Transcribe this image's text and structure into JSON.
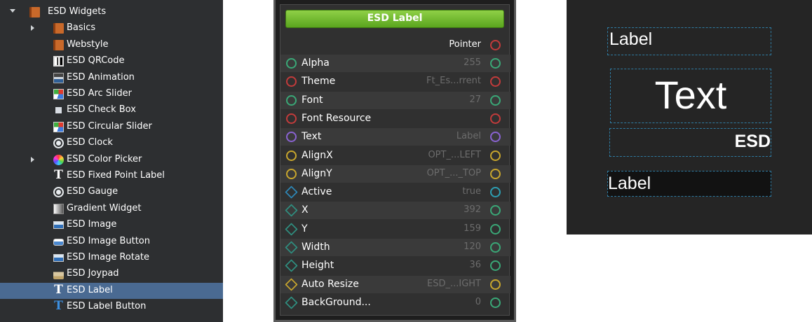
{
  "tree": {
    "items": [
      {
        "label": "ESD Widgets",
        "icon": "folder-book-icon",
        "expand": "expanded"
      },
      {
        "label": "Basics",
        "icon": "folder-book-icon",
        "expand": "collapsed"
      },
      {
        "label": "Webstyle",
        "icon": "folder-book-icon",
        "expand": "none"
      },
      {
        "label": "ESD QRCode",
        "icon": "qr-code-icon",
        "expand": "none"
      },
      {
        "label": "ESD Animation",
        "icon": "animation-icon",
        "expand": "none"
      },
      {
        "label": "ESD Arc Slider",
        "icon": "arc-slider-icon",
        "expand": "none"
      },
      {
        "label": "ESD Check Box",
        "icon": "checkbox-icon",
        "expand": "none"
      },
      {
        "label": "ESD Circular Slider",
        "icon": "circular-slider-icon",
        "expand": "none"
      },
      {
        "label": "ESD Clock",
        "icon": "clock-icon",
        "expand": "none"
      },
      {
        "label": "ESD Color Picker",
        "icon": "color-wheel-icon",
        "expand": "collapsed"
      },
      {
        "label": "ESD Fixed Point Label",
        "icon": "text-t-icon",
        "expand": "none"
      },
      {
        "label": "ESD Gauge",
        "icon": "gauge-icon",
        "expand": "none"
      },
      {
        "label": "Gradient Widget",
        "icon": "gradient-icon",
        "expand": "none"
      },
      {
        "label": "ESD Image",
        "icon": "image-icon",
        "expand": "none"
      },
      {
        "label": "ESD Image Button",
        "icon": "image-button-icon",
        "expand": "none"
      },
      {
        "label": "ESD Image Rotate",
        "icon": "image-rotate-icon",
        "expand": "none"
      },
      {
        "label": "ESD Joypad",
        "icon": "joypad-icon",
        "expand": "none"
      },
      {
        "label": "ESD Label",
        "icon": "text-t-icon",
        "expand": "none",
        "selected": true
      },
      {
        "label": "ESD Label Button",
        "icon": "text-t-blue-icon",
        "expand": "none"
      }
    ]
  },
  "node": {
    "title": "ESD Label",
    "output_label": "Pointer",
    "properties": [
      {
        "name": "Alpha",
        "value": "255",
        "left_port": "circle-teal",
        "right_port": "circle-teal"
      },
      {
        "name": "Theme",
        "value": "Ft_Es...rrent",
        "left_port": "circle-red",
        "right_port": "circle-red"
      },
      {
        "name": "Font",
        "value": "27",
        "left_port": "circle-teal",
        "right_port": "circle-teal"
      },
      {
        "name": "Font Resource",
        "value": "",
        "left_port": "circle-red",
        "right_port": "circle-red"
      },
      {
        "name": "Text",
        "value": "Label",
        "left_port": "circle-purple",
        "right_port": "circle-purple"
      },
      {
        "name": "AlignX",
        "value": "OPT_...LEFT",
        "left_port": "circle-gold",
        "right_port": "circle-gold"
      },
      {
        "name": "AlignY",
        "value": "OPT_..._TOP",
        "left_port": "circle-gold",
        "right_port": "circle-gold"
      },
      {
        "name": "Active",
        "value": "true",
        "left_port": "diamond-blue",
        "right_port": "circle-cyan"
      },
      {
        "name": "X",
        "value": "392",
        "left_port": "diamond-teal",
        "right_port": "circle-teal"
      },
      {
        "name": "Y",
        "value": "159",
        "left_port": "diamond-teal",
        "right_port": "circle-teal"
      },
      {
        "name": "Width",
        "value": "120",
        "left_port": "diamond-teal",
        "right_port": "circle-teal"
      },
      {
        "name": "Height",
        "value": "36",
        "left_port": "diamond-teal",
        "right_port": "circle-teal"
      },
      {
        "name": "Auto Resize",
        "value": "ESD_...IGHT",
        "left_port": "diamond-gold",
        "right_port": "circle-gold"
      },
      {
        "name": "BackGround...",
        "value": "0",
        "left_port": "diamond-teal",
        "right_port": "circle-teal"
      }
    ]
  },
  "preview": {
    "label_1": "Label",
    "label_2": "Text",
    "label_3": "ESD",
    "label_4": "Label"
  },
  "colors": {
    "selection": "#4a6a92",
    "title_bar": "#6fbb2e",
    "preview_border": "#2f7ca3"
  }
}
